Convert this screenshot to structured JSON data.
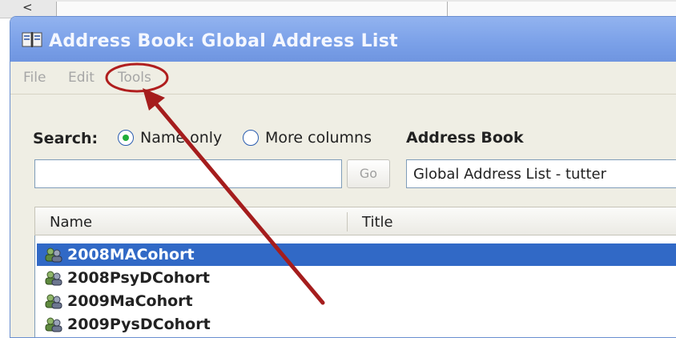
{
  "background": {
    "back_glyph": "<"
  },
  "window": {
    "title": "Address Book: Global Address List",
    "icon": "address-book-icon"
  },
  "menu": {
    "items": [
      "File",
      "Edit",
      "Tools"
    ]
  },
  "search": {
    "label": "Search:",
    "option_name_only": "Name only",
    "option_more_columns": "More columns",
    "selected_option": "Name only",
    "input_value": "",
    "go_label": "Go"
  },
  "address_book": {
    "label": "Address Book",
    "selected_value": "Global Address List - tutter"
  },
  "list": {
    "columns": [
      "Name",
      "Title"
    ],
    "rows": [
      {
        "name": "2008MACohort",
        "icon": "distribution-group-icon",
        "selected": true
      },
      {
        "name": "2008PsyDCohort",
        "icon": "distribution-group-icon",
        "selected": false
      },
      {
        "name": "2009MaCohort",
        "icon": "distribution-group-icon",
        "selected": false
      },
      {
        "name": "2009PysDCohort",
        "icon": "distribution-group-icon",
        "selected": false
      }
    ]
  },
  "annotation": {
    "circle_color": "#b01e1e",
    "arrow_color": "#a51d1d",
    "target": "Tools"
  },
  "colors": {
    "titlebar": "#7aa0e8",
    "selection": "#3169c6",
    "dialog_bg": "#efeee4"
  }
}
